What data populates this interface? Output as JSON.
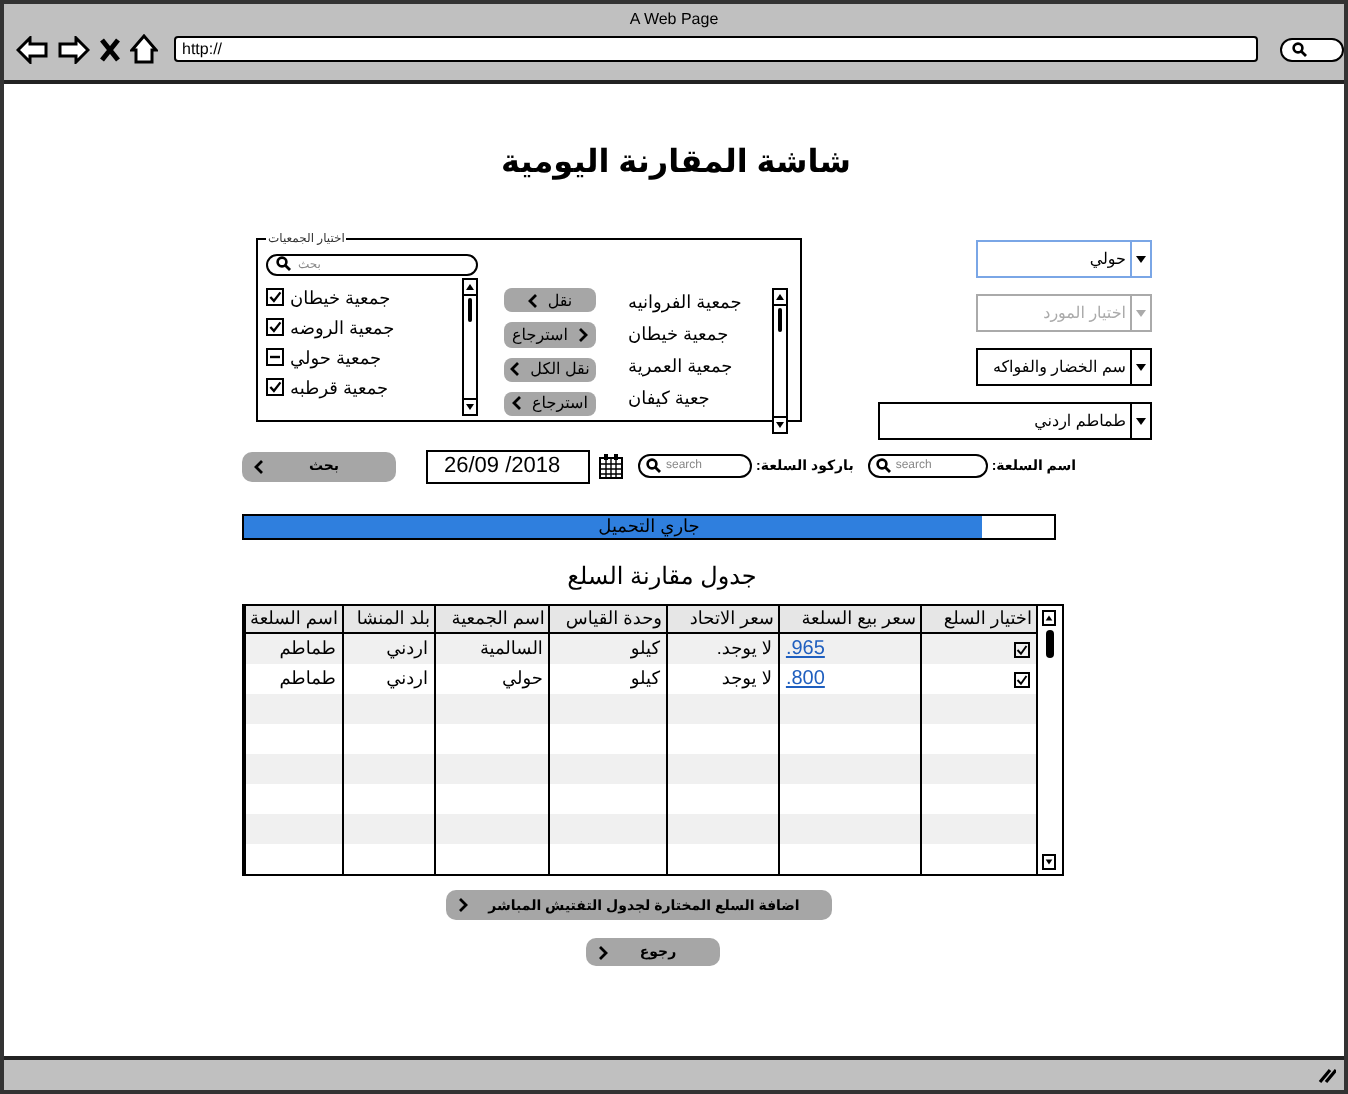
{
  "window": {
    "title": "A Web Page",
    "url": "http://"
  },
  "page_title": "شاشة المقارنة اليومية",
  "societies": {
    "legend": "اختيار الجمعيات",
    "search": {
      "placeholder": "بحث"
    },
    "selected": [
      {
        "label": "جمعية خيطان",
        "checked": true,
        "indeterminate": false
      },
      {
        "label": "جمعية الروضه",
        "checked": true,
        "indeterminate": false
      },
      {
        "label": "جمعية حولي",
        "checked": false,
        "indeterminate": true
      },
      {
        "label": "جمعية قرطبه",
        "checked": true,
        "indeterminate": false
      }
    ],
    "buttons": [
      {
        "label": "نقل",
        "chevron_right": false
      },
      {
        "label": "استرجاع",
        "chevron_right": true
      },
      {
        "label": "نقل الكل",
        "chevron_right": false
      },
      {
        "label": "استرجاع",
        "chevron_right": false
      }
    ],
    "available": [
      "جمعية الفروانيه",
      "جمعية خيطان",
      "جمعية العمرية",
      "جعية كيفان"
    ]
  },
  "filters": [
    {
      "value": "حولي",
      "focused": true,
      "disabled": false
    },
    {
      "placeholder": "اختيار المورد",
      "focused": false,
      "disabled": true
    },
    {
      "value": "سم الخضار والفواكه",
      "focused": false,
      "disabled": false
    },
    {
      "value": "طماطم اردني",
      "focused": false,
      "disabled": false
    }
  ],
  "search_row": {
    "button": "بحث",
    "date": "26/09 /2018",
    "barcode": {
      "label": "باركود السلعة:",
      "placeholder": "search"
    },
    "item_name": {
      "label": "اسم السلعة:",
      "placeholder": "search"
    }
  },
  "progress": {
    "label": "جاري التحميل",
    "level": 0.91
  },
  "table": {
    "title": "جدول مقارنة السلع",
    "columns": [
      "اختيار السلع",
      "سعر بيع السلعة",
      "سعر الاتحاد",
      "وحدة القياس",
      "اسم الجمعية",
      "بلد المنشا",
      "اسم السلعة"
    ],
    "rows": [
      {
        "checked": true,
        "price": ".965",
        "union_price": "لا يوجد.",
        "unit": "كيلو",
        "society": "السالمية",
        "origin": "اردني",
        "item": "طماطم"
      },
      {
        "checked": true,
        "price": ".800",
        "union_price": "لا يوجد",
        "unit": "كيلو",
        "society": "حولي",
        "origin": "اردني",
        "item": "طماطم"
      }
    ]
  },
  "buttons": [
    {
      "label": "اضافة السلع المختارة لجدول التفتيش المباشر"
    },
    {
      "label": "رجوع"
    }
  ]
}
